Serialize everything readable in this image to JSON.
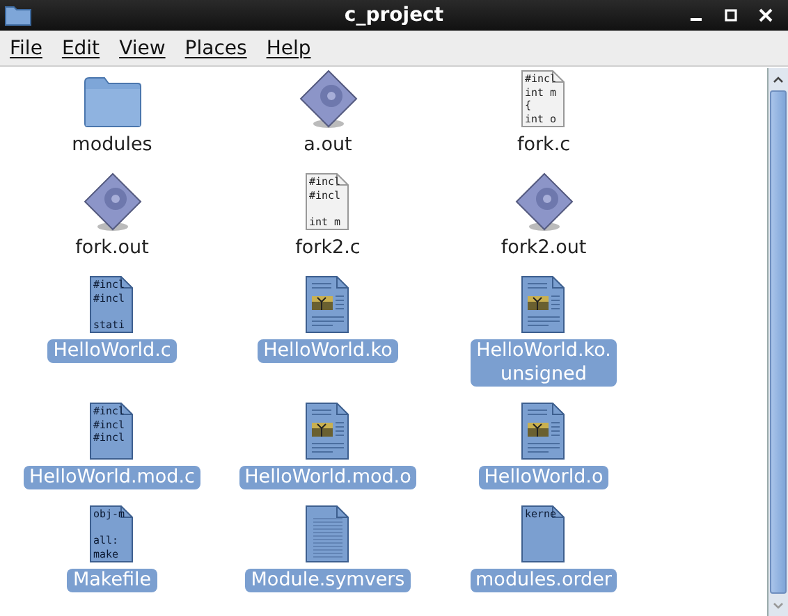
{
  "window": {
    "title": "c_project"
  },
  "menu": [
    "File",
    "Edit",
    "View",
    "Places",
    "Help"
  ],
  "files": [
    {
      "name": "modules",
      "kind": "folder",
      "selected": false
    },
    {
      "name": "a.out",
      "kind": "executable",
      "selected": false
    },
    {
      "name": "fork.c",
      "kind": "source",
      "selected": false,
      "preview": [
        {
          "text": "#incl",
          "spaced": false
        },
        {
          "text": "int m",
          "spaced": false
        },
        {
          "text": "{",
          "spaced": false
        },
        {
          "text": "int o",
          "spaced": false
        }
      ]
    },
    {
      "name": "fork.out",
      "kind": "executable",
      "selected": false
    },
    {
      "name": "fork2.c",
      "kind": "source",
      "selected": false,
      "preview": [
        {
          "text": "#incl",
          "spaced": false
        },
        {
          "text": "#incl",
          "spaced": false
        },
        {
          "text": "int m",
          "spaced": true
        }
      ]
    },
    {
      "name": "fork2.out",
      "kind": "executable",
      "selected": false
    },
    {
      "name": "HelloWorld.c",
      "kind": "source",
      "selected": true,
      "preview": [
        {
          "text": "#incl",
          "spaced": false
        },
        {
          "text": "#incl",
          "spaced": false
        },
        {
          "text": "stati",
          "spaced": true
        }
      ]
    },
    {
      "name": "HelloWorld.ko",
      "kind": "object",
      "selected": true
    },
    {
      "name": "HelloWorld.ko.\nunsigned",
      "kind": "object",
      "selected": true
    },
    {
      "name": "HelloWorld.mod.c",
      "kind": "source",
      "selected": true,
      "preview": [
        {
          "text": "#incl",
          "spaced": false
        },
        {
          "text": "#incl",
          "spaced": false
        },
        {
          "text": "#incl",
          "spaced": false
        }
      ]
    },
    {
      "name": "HelloWorld.mod.o",
      "kind": "object",
      "selected": true
    },
    {
      "name": "HelloWorld.o",
      "kind": "object",
      "selected": true
    },
    {
      "name": "Makefile",
      "kind": "source",
      "selected": true,
      "preview": [
        {
          "text": "obj-m",
          "spaced": false
        },
        {
          "text": "all:",
          "spaced": true
        },
        {
          "text": "make",
          "spaced": false
        }
      ]
    },
    {
      "name": "Module.symvers",
      "kind": "text",
      "selected": true
    },
    {
      "name": "modules.order",
      "kind": "source",
      "selected": true,
      "preview": [
        {
          "text": "kerne",
          "spaced": false
        }
      ]
    }
  ]
}
